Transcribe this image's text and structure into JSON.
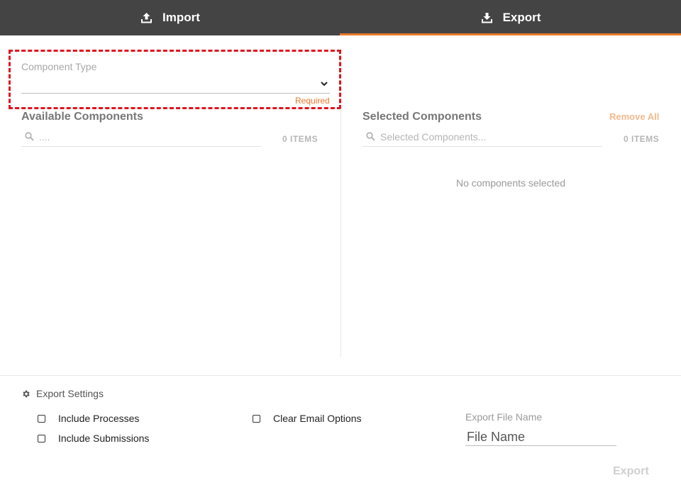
{
  "tabs": [
    {
      "label": "Import",
      "icon": "upload-icon",
      "active": false
    },
    {
      "label": "Export",
      "icon": "download-icon",
      "active": true
    }
  ],
  "accent_color": "#e8782b",
  "highlight_color": "#e0141e",
  "component_type": {
    "label": "Component Type",
    "value": "",
    "required_text": "Required"
  },
  "available": {
    "title": "Available Components",
    "search_placeholder": "....",
    "count": "0 ITEMS"
  },
  "selected": {
    "title": "Selected Components",
    "remove_all": "Remove All",
    "search_placeholder": "Selected Components...",
    "count": "0 ITEMS",
    "empty_message": "No components selected"
  },
  "settings": {
    "title": "Export Settings",
    "options": [
      {
        "label": "Include Processes",
        "checked": false
      },
      {
        "label": "Include Submissions",
        "checked": false
      },
      {
        "label": "Clear Email Options",
        "checked": false
      }
    ],
    "file_name_label": "Export File Name",
    "file_name_placeholder": "File Name",
    "export_button": "Export"
  }
}
